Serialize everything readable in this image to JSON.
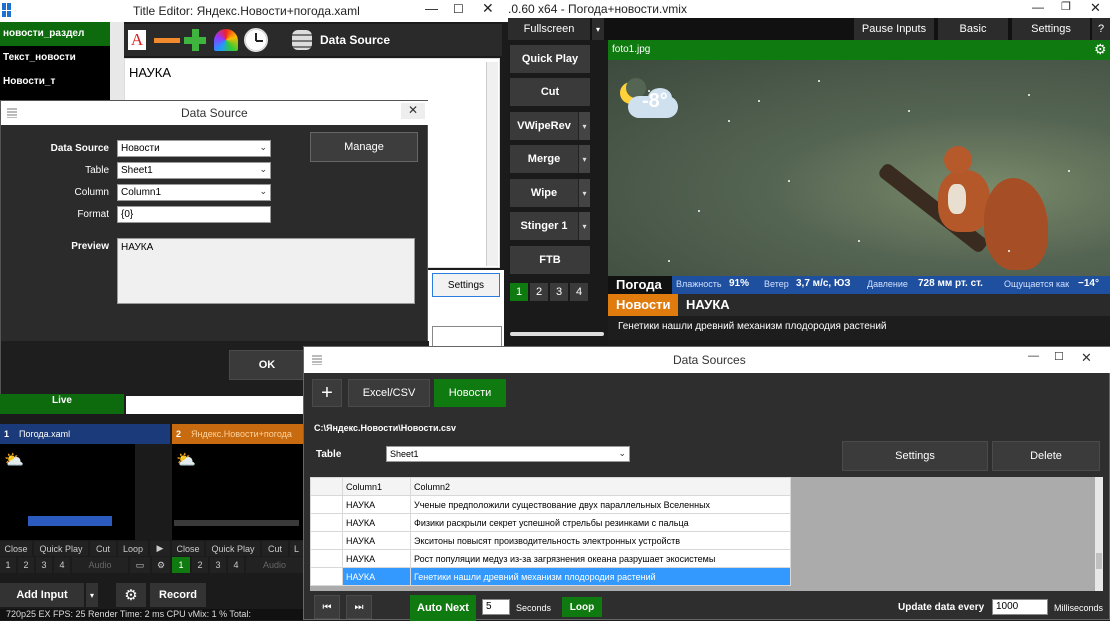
{
  "title_editor": {
    "window_title": "Title Editor: Яндекс.Новости+погода.xaml",
    "sidebar": [
      "новости_раздел",
      "Текст_новости",
      "Новости_т"
    ],
    "toolbar": {
      "data_source_label": "Data Source"
    },
    "canvas_text": "НАУКА",
    "settings_label": "Settings"
  },
  "data_source_dialog": {
    "title": "Data Source",
    "labels": {
      "data_source": "Data Source",
      "table": "Table",
      "column": "Column",
      "format": "Format",
      "preview": "Preview"
    },
    "values": {
      "data_source": "Новости",
      "table": "Sheet1",
      "column": "Column1",
      "format": "{0}",
      "preview": "НАУКА"
    },
    "manage_label": "Manage",
    "ok_label": "OK"
  },
  "vmix": {
    "window_title": ".0.60 x64 - Погода+новости.vmix",
    "fullscreen_label": "Fullscreen",
    "top_buttons": [
      "Pause Inputs",
      "Basic",
      "Settings",
      "?"
    ],
    "transitions": [
      "Quick Play",
      "Cut",
      "VWipeRev",
      "Merge",
      "Wipe",
      "Stinger 1",
      "FTB"
    ],
    "transition_numbers": [
      "1",
      "2",
      "3",
      "4"
    ],
    "preview_file": "foto1.jpg",
    "weather_temp": "-8°",
    "ticker": {
      "pogoda": "Погода",
      "humidity_label": "Влажность",
      "humidity_value": "91%",
      "wind_label": "Ветер",
      "wind_value": "3,7 м/с, ЮЗ",
      "pressure_label": "Давление",
      "pressure_value": "728 мм рт. ст.",
      "feels_label": "Ощущается как",
      "feels_value": "−14°",
      "news_label": "Новости",
      "news_category": "НАУКА",
      "headline": "Генетики нашли древний механизм плодородия растений"
    },
    "live_label": "Live",
    "inputs": [
      {
        "number": "1",
        "name": "Погода.xaml"
      },
      {
        "number": "2",
        "name": "Яндекс.Новости+погода"
      }
    ],
    "input_controls": [
      "Close",
      "Quick Play",
      "Cut",
      "Loop"
    ],
    "input_numbers": [
      "1",
      "2",
      "3",
      "4"
    ],
    "audio_label": "Audio",
    "add_input_label": "Add Input",
    "record_label": "Record",
    "status_text": "720p25   EX  FPS: 25  Render Time: 2 ms  CPU vMix: 1 %  Total:"
  },
  "data_sources": {
    "title": "Data Sources",
    "tabs": [
      "Excel/CSV",
      "Новости"
    ],
    "path": "C:\\Яндекс.Новости\\Новости.csv",
    "table_label": "Table",
    "table_value": "Sheet1",
    "settings_label": "Settings",
    "delete_label": "Delete",
    "columns": [
      "Column1",
      "Column2"
    ],
    "rows": [
      [
        "НАУКА",
        "Ученые предположили существование двух параллельных Вселенных"
      ],
      [
        "НАУКА",
        "Физики раскрыли секрет успешной стрельбы резинками с пальца"
      ],
      [
        "НАУКА",
        "Экситоны повысят производительность электронных устройств"
      ],
      [
        "НАУКА",
        "Рост популяции медуз из-за загрязнения океана разрушает экосистемы"
      ],
      [
        "НАУКА",
        "Генетики нашли древний механизм плодородия растений"
      ]
    ],
    "auto_next_label": "Auto Next",
    "seconds_value": "5",
    "seconds_label": "Seconds",
    "loop_label": "Loop",
    "update_label": "Update data every",
    "update_value": "1000",
    "ms_label": "Milliseconds"
  }
}
